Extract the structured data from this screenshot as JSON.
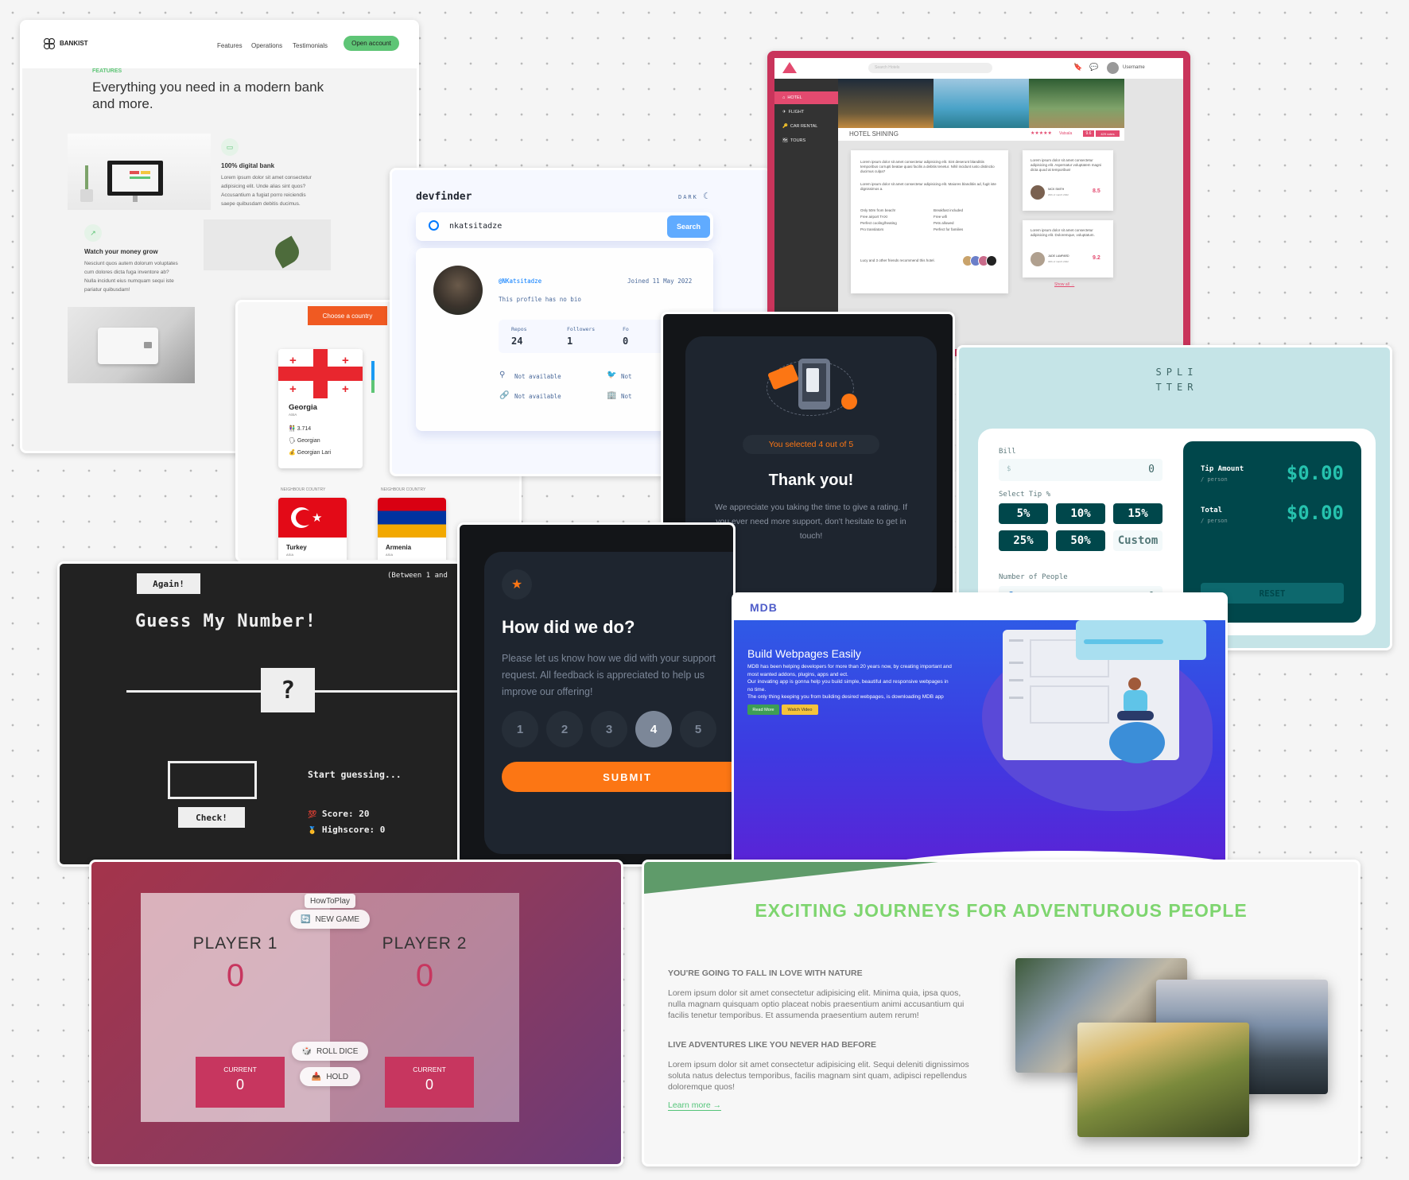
{
  "bankist": {
    "logo": "BANKIST",
    "nav": [
      "Features",
      "Operations",
      "Testimonials"
    ],
    "cta": "Open account",
    "section_label": "FEATURES",
    "heading": "Everything you need in a modern bank and more.",
    "feature1_title": "100% digital bank",
    "feature1_text": "Lorem ipsum dolor sit amet consectetur adipisicing elit. Unde alias sint quos? Accusantium a fugiat porro reiciendis saepe quibusdam debitis ducimus.",
    "feature2_title": "Watch your money grow",
    "feature2_text": "Nesciunt quos autem dolorum voluptates cum dolores dicta fuga inventore ab? Nulla incidunt eius numquam sequi iste pariatur quibusdam!",
    "accent": "#5ec576"
  },
  "countries": {
    "choose_button": "Choose a country",
    "main": {
      "name": "Georgia",
      "region": "ASIA",
      "population": "3.714",
      "language": "Georgian",
      "currency": "Georgian Lari"
    },
    "neighbour_label": "NEIGHBOUR COUNTRY",
    "neighbours": [
      {
        "name": "Turkey",
        "region": "ASIA"
      },
      {
        "name": "Armenia",
        "region": "ASIA"
      }
    ]
  },
  "devfinder": {
    "logo": "devfinder",
    "theme_toggle": "DARK",
    "search_value": "nkatsitadze",
    "search_button": "Search",
    "username": "@NKatsitadze",
    "joined": "Joined 11 May 2022",
    "bio": "This profile has no bio",
    "stats": [
      {
        "label": "Repos",
        "value": "24"
      },
      {
        "label": "Followers",
        "value": "1"
      },
      {
        "label": "Fo",
        "value": "0"
      }
    ],
    "location": "Not available",
    "blog": "Not available",
    "twitter": "Not",
    "company": "Not"
  },
  "hotel": {
    "search_placeholder": "Search Hotels",
    "username": "Username",
    "sidebar": [
      "HOTEL",
      "FLIGHT",
      "CAR RENTAL",
      "TOURS"
    ],
    "title": "HOTEL SHINING",
    "stars": "★★★★★",
    "location": "Vatsala",
    "score": "9.6",
    "reviews_badge": "429 votes",
    "desc1": "Lorem ipsum dolor sit amet consectetur adipisicing elit. Sint deserunt blanditiis temporibus corrupti beatae quasi facilis a debitis tenetur. Nihil incidunt iusto distinctio ducimus culpa?",
    "desc2": "Lorem ipsum dolor sit amet consectetur adipisicing elit. Maiores blanditiis ad, fugit iste dignissimos a.",
    "features_left": [
      "Only 50m from beach!",
      "Free airport TAXI",
      "Perfect cooling/heating",
      "Pro translators"
    ],
    "features_right": [
      "Breakfast included",
      "Free wifi",
      "Pets allowed",
      "Perfect for families"
    ],
    "recommend": "Lucy and 3 other friends recommend this hotel.",
    "reviews": [
      {
        "text": "Lorem ipsum dolor sit amet consectetur adipisicing elit. Aspernatur voluptatem magni dicta quod at temporibus!",
        "name": "NICK SMITH",
        "date": "20th of march 2022",
        "score": "8.5"
      },
      {
        "text": "Lorem ipsum dolor sit amet consectetur adipisicing elit. Doloremque, voluptatum.",
        "name": "JADE LAMPARD",
        "date": "30th of march 2022",
        "score": "9.2"
      }
    ],
    "show_all": "Show all →",
    "accent": "#c9345b"
  },
  "thanks": {
    "selected": "You selected 4 out of 5",
    "title": "Thank you!",
    "text": "We appreciate you taking the time to give a rating. If you ever need more support, don't hesitate to get in touch!"
  },
  "splitter": {
    "logo_line1": "SPLI",
    "logo_line2": "TTER",
    "bill_label": "Bill",
    "bill_prefix": "$",
    "bill_value": "0",
    "tip_label": "Select Tip %",
    "tips": [
      "5%",
      "10%",
      "15%",
      "25%",
      "50%"
    ],
    "custom": "Custom",
    "people_label": "Number of People",
    "people_value": "0",
    "tip_amount_label": "Tip Amount",
    "per_person": "/ person",
    "tip_amount": "$0.00",
    "total_label": "Total",
    "total": "$0.00",
    "reset": "RESET"
  },
  "guess": {
    "again": "Again!",
    "between": "(Between 1 and",
    "title": "Guess My Number!",
    "secret": "?",
    "message": "Start guessing...",
    "score_label": "Score:",
    "score": "20",
    "highscore_label": "Highscore:",
    "highscore": "0",
    "check": "Check!"
  },
  "howdid": {
    "title": "How did we do?",
    "text": "Please let us know how we did with your support request. All feedback is appreciated to help us improve our offering!",
    "ratings": [
      "1",
      "2",
      "3",
      "4",
      "5"
    ],
    "selected": "4",
    "submit": "SUBMIT",
    "accent": "#fc7614"
  },
  "mdb": {
    "logo": "MDB",
    "title": "Build Webpages Easily",
    "text1": "MDB has been helping developers for more than 20 years now, by creating important and most wanted addons, plugins, apps and ect.",
    "text2": "Our inovating app is gonna help you build simple, beautiful and responsive webpages in no time.",
    "text3": "The only thing keeping you from building desired webpages, is downloading MDB app",
    "read_more": "Read More",
    "watch_video": "Watch Video"
  },
  "pig": {
    "how_to_play": "HowToPlay",
    "new_game": "NEW GAME",
    "player1": "PLAYER 1",
    "player2": "PLAYER 2",
    "score1": "0",
    "score2": "0",
    "current_label": "CURRENT",
    "current1": "0",
    "current2": "0",
    "roll": "ROLL DICE",
    "hold": "HOLD"
  },
  "natours": {
    "heading": "EXCITING JOURNEYS FOR ADVENTUROUS PEOPLE",
    "h1": "YOU'RE GOING TO FALL IN LOVE WITH NATURE",
    "p1": "Lorem ipsum dolor sit amet consectetur adipisicing elit. Minima quia, ipsa quos, nulla magnam quisquam optio placeat nobis praesentium animi accusantium qui facilis tenetur temporibus. Et assumenda praesentium autem rerum!",
    "h2": "LIVE ADVENTURES LIKE YOU NEVER HAD BEFORE",
    "p2": "Lorem ipsum dolor sit amet consectetur adipisicing elit. Sequi deleniti dignissimos soluta natus delectus temporibus, facilis magnam sint quam, adipisci repellendus doloremque quos!",
    "learn_more": "Learn more →",
    "accent": "#7ed56f"
  }
}
